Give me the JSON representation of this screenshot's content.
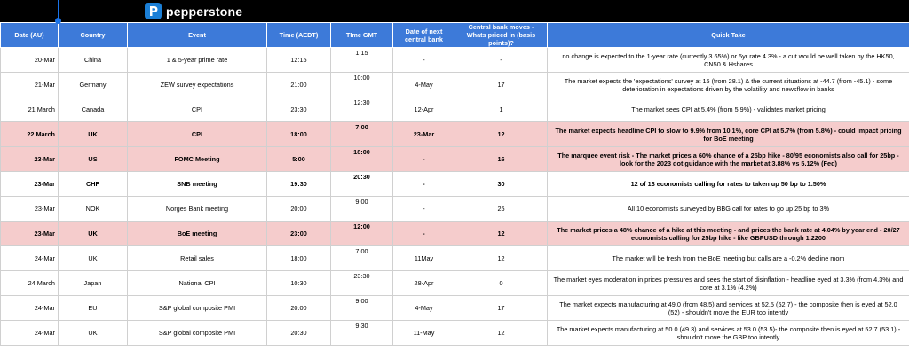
{
  "brand": {
    "name": "pepperstone",
    "logo_letter": "P"
  },
  "columns": [
    "Date (AU)",
    "Country",
    "Event",
    "Time (AEDT)",
    "TIme GMT",
    "Date of next central bank",
    "Central bank moves - Whats priced in (basis points)?",
    "Quick Take"
  ],
  "rows": [
    {
      "date": "20-Mar",
      "country": "China",
      "event": "1 & 5-year prime rate",
      "aedt": "12:15",
      "gmt": "1:15",
      "next_cb": "-",
      "priced": "-",
      "take": "no change is expected to the 1-year rate (currently 3.65%) or 5yr rate 4.3% - a cut would be well taken by the HK50, CN50 & Hshares",
      "style": "normal"
    },
    {
      "date": "21-Mar",
      "country": "Germany",
      "event": "ZEW survey expectations",
      "aedt": "21:00",
      "gmt": "10:00",
      "next_cb": "4-May",
      "priced": "17",
      "take": "The market expects the 'expectations' survey at 15 (from 28.1) & the current situations at -44.7 (from -45.1) - some deterioration in expectations driven by the volatility and newsflow in banks",
      "style": "normal"
    },
    {
      "date": "21 March",
      "country": "Canada",
      "event": "CPI",
      "aedt": "23:30",
      "gmt": "12:30",
      "next_cb": "12-Apr",
      "priced": "1",
      "take": "The market sees CPI at 5.4% (from 5.9%) - validates market pricing",
      "style": "normal"
    },
    {
      "date": "22 March",
      "country": "UK",
      "event": "CPI",
      "aedt": "18:00",
      "gmt": "7:00",
      "next_cb": "23-Mar",
      "priced": "12",
      "take": "The market expects headline CPI to slow to 9.9% from 10.1%, core CPI at 5.7% (from 5.8%) - could impact pricing for BoE meeting",
      "style": "hl"
    },
    {
      "date": "23-Mar",
      "country": "US",
      "event": "FOMC Meeting",
      "aedt": "5:00",
      "gmt": "18:00",
      "next_cb": "-",
      "priced": "16",
      "take": "The marquee event risk - The market prices a 60% chance of a 25bp hike - 80/95 economists also call for 25bp - look for the 2023 dot guidance with the market at 3.88% vs 5.12% (Fed)",
      "style": "hl"
    },
    {
      "date": "23-Mar",
      "country": "CHF",
      "event": "SNB meeting",
      "aedt": "19:30",
      "gmt": "20:30",
      "next_cb": "-",
      "priced": "30",
      "take": "12 of 13 economists calling for rates to taken up 50 bp to 1.50%",
      "style": "bold"
    },
    {
      "date": "23-Mar",
      "country": "NOK",
      "event": "Norges Bank meeting",
      "aedt": "20:00",
      "gmt": "9:00",
      "next_cb": "-",
      "priced": "25",
      "take": "All 10 economists surveyed by BBG call for rates to go up 25 bp to 3%",
      "style": "normal"
    },
    {
      "date": "23-Mar",
      "country": "UK",
      "event": "BoE meeting",
      "aedt": "23:00",
      "gmt": "12:00",
      "next_cb": "-",
      "priced": "12",
      "take": "The market prices a 48% chance of a hike at this meeting - and prices the bank rate at 4.04% by year end - 20/27 economists calling for 25bp hike - like GBPUSD through 1.2200",
      "style": "hl"
    },
    {
      "date": "24-Mar",
      "country": "UK",
      "event": "Retail sales",
      "aedt": "18:00",
      "gmt": "7:00",
      "next_cb": "11May",
      "priced": "12",
      "take": "The market will be fresh from the BoE meeting but calls are a -0.2% decline mom",
      "style": "normal"
    },
    {
      "date": "24 March",
      "country": "Japan",
      "event": "National CPI",
      "aedt": "10:30",
      "gmt": "23:30",
      "next_cb": "28-Apr",
      "priced": "0",
      "take": "The market eyes moderation in prices pressures and sees the start of disinflation - headline eyed at 3.3% (from 4.3%) and core at 3.1% (4.2%)",
      "style": "normal"
    },
    {
      "date": "24-Mar",
      "country": "EU",
      "event": "S&P global composite PMI",
      "aedt": "20:00",
      "gmt": "9:00",
      "next_cb": "4-May",
      "priced": "17",
      "take": "The market expects manufacturing at 49.0 (from 48.5) and services at 52.5 (52.7) - the composite then is eyed at 52.0 (52) - shouldn't move the EUR too intently",
      "style": "normal"
    },
    {
      "date": "24-Mar",
      "country": "UK",
      "event": "S&P global composite PMI",
      "aedt": "20:30",
      "gmt": "9:30",
      "next_cb": "11-May",
      "priced": "12",
      "take": "The market expects manufacturing at 50.0 (49.3) and services at 53.0 (53.5)- the composite then is eyed at 52.7 (53.1) - shouldn't move the GBP too intently",
      "style": "normal"
    }
  ]
}
